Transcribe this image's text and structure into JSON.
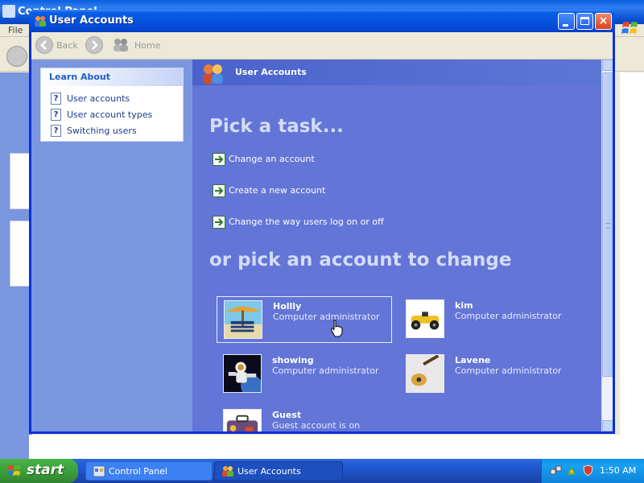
{
  "background_window": {
    "title": "Control Panel",
    "menu_file": "File"
  },
  "window": {
    "title": "User Accounts",
    "close_glyph": "×"
  },
  "nav": {
    "back_label": "Back",
    "home_label": "Home"
  },
  "sidebar": {
    "learn_about": {
      "heading": "Learn About",
      "items": [
        {
          "label": "User accounts",
          "icon": "help-icon"
        },
        {
          "label": "User account types",
          "icon": "help-icon"
        },
        {
          "label": "Switching users",
          "icon": "help-icon"
        }
      ]
    }
  },
  "main": {
    "banner_title": "User Accounts",
    "pick_task_heading": "Pick a task...",
    "tasks": [
      {
        "label": "Change an account"
      },
      {
        "label": "Create a new account"
      },
      {
        "label": "Change the way users log on or off"
      }
    ],
    "pick_account_heading": "or pick an account to change",
    "accounts": [
      {
        "name": "Hollly",
        "type": "Computer administrator",
        "picture": "beach-chair-picture",
        "selected": true
      },
      {
        "name": "kim",
        "type": "Computer administrator",
        "picture": "race-car-picture",
        "selected": false
      },
      {
        "name": "showing",
        "type": "Computer administrator",
        "picture": "astronaut-picture",
        "selected": false
      },
      {
        "name": "Lavene",
        "type": "Computer administrator",
        "picture": "guitar-picture",
        "selected": false
      },
      {
        "name": "Guest",
        "type": "Guest account is on",
        "picture": "suitcase-picture",
        "selected": false
      }
    ]
  },
  "taskbar": {
    "start_label": "start",
    "buttons": [
      {
        "label": "Control Panel",
        "active": false
      },
      {
        "label": "User Accounts",
        "active": true
      }
    ],
    "clock": "1:50 AM"
  },
  "colors": {
    "content_bg": "#6375d6",
    "sidebar_bg": "#7a96df",
    "title_bar": "#0553e0",
    "heading_text": "#d3dcf8",
    "task_arrow": "#2d7a2d"
  }
}
